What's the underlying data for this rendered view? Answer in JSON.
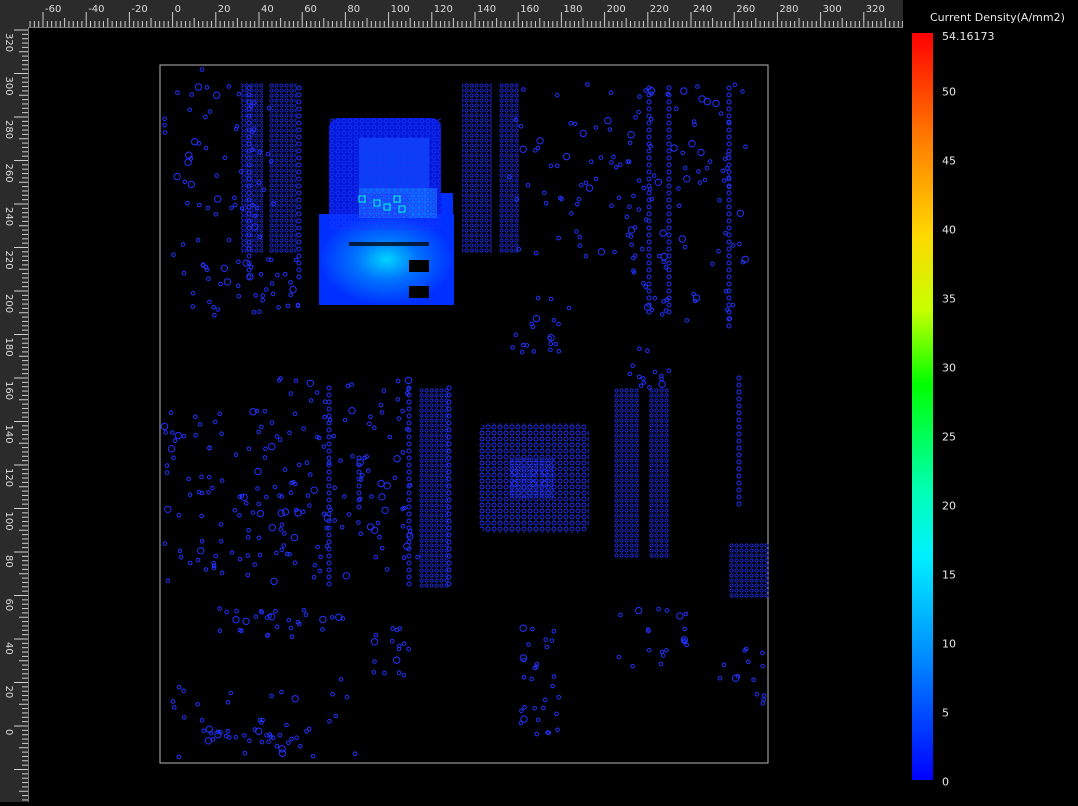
{
  "ruler": {
    "h_ticks": [
      "-60",
      "-40",
      "-20",
      "0",
      "20",
      "40",
      "60",
      "80",
      "100",
      "120",
      "140",
      "160",
      "180",
      "200",
      "220",
      "240",
      "260",
      "280",
      "300",
      "320"
    ],
    "v_ticks": [
      "320",
      "300",
      "280",
      "260",
      "240",
      "220",
      "200",
      "180",
      "160",
      "140",
      "120",
      "100",
      "80",
      "60",
      "40",
      "20",
      "0"
    ]
  },
  "legend": {
    "title": "Current Density(A/mm2)",
    "max_label": "54.16173",
    "ticks": [
      "50",
      "45",
      "40",
      "35",
      "30",
      "25",
      "20",
      "15",
      "10",
      "5",
      "0"
    ],
    "colors": {
      "max": "#ff0000",
      "mid": "#00ff00",
      "min": "#0000ff"
    }
  },
  "board": {
    "outline_color": "#b5b5b5",
    "via_color": "#2233ff",
    "hotspot_color": "#00e8ff"
  }
}
